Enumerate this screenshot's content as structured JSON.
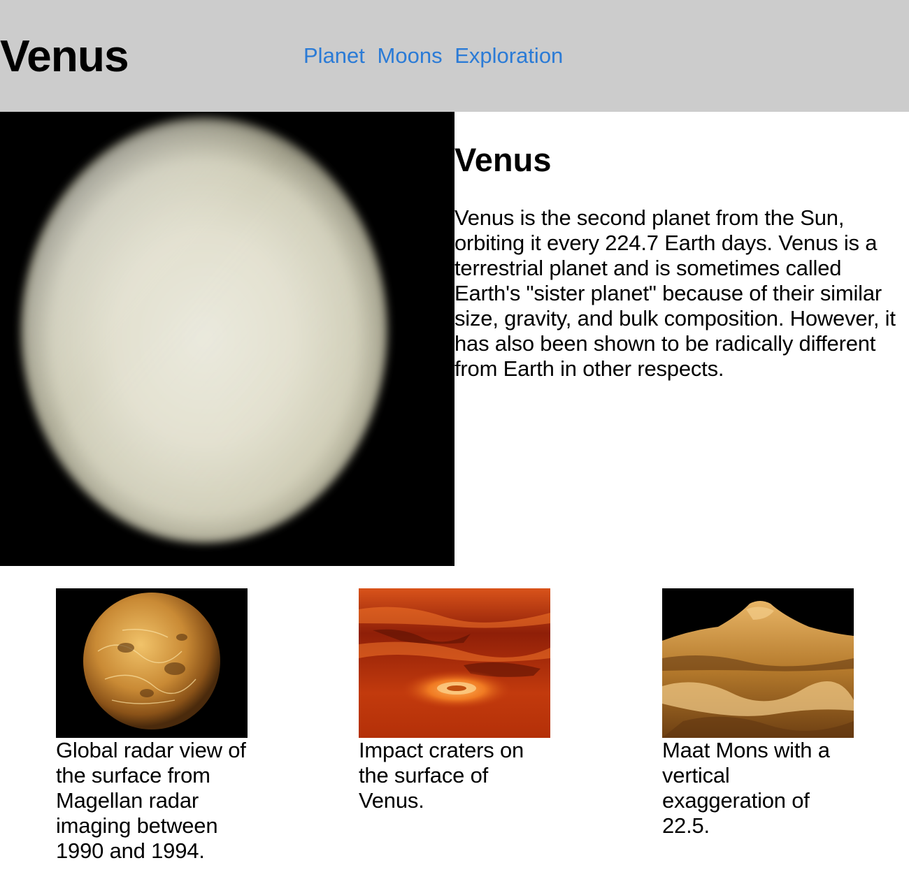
{
  "header": {
    "title": "Venus",
    "nav": [
      {
        "label": "Planet"
      },
      {
        "label": "Moons"
      },
      {
        "label": "Exploration"
      }
    ]
  },
  "intro": {
    "heading": "Venus",
    "text": "Venus is the second planet from the Sun, orbiting it every 224.7 Earth days. Venus is a terrestrial planet and is sometimes called Earth's \"sister planet\" because of their similar size, gravity, and bulk composition. However, it has also been shown to be radically different from Earth in other respects."
  },
  "gallery": [
    {
      "caption": "Global radar view of the surface from Magellan radar imaging between 1990 and 1994."
    },
    {
      "caption": "Impact craters on the surface of Venus."
    },
    {
      "caption": "Maat Mons with a vertical exaggeration of 22.5."
    }
  ],
  "colors": {
    "header_bg": "#cccccc",
    "nav_link": "#2b7bd6"
  }
}
